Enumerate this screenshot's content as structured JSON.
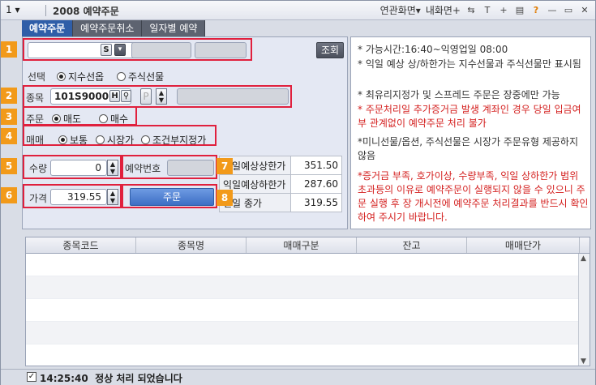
{
  "titlebar": {
    "screen_number": "1 ▾",
    "title": "2008 예약주문",
    "linked_screen": "연관화면▾",
    "my_screen": "내화면+",
    "help_icon_text": "?"
  },
  "tabs": [
    {
      "label": "예약주문"
    },
    {
      "label": "예약주문취소"
    },
    {
      "label": "일자별 예약"
    }
  ],
  "account": {
    "s_button": "S",
    "query_button": "조회"
  },
  "selection": {
    "label": "선택",
    "options": [
      "지수선옵",
      "주식선물"
    ]
  },
  "item": {
    "label": "종목",
    "code": "101S9000",
    "h_button": "H",
    "p_button": "P"
  },
  "order": {
    "label": "주문",
    "options": [
      "매도",
      "매수"
    ]
  },
  "trade": {
    "label": "매매",
    "options": [
      "보통",
      "시장가",
      "조건부지정가"
    ]
  },
  "quantity": {
    "label": "수량",
    "value": "0",
    "reservation_label": "예약번호"
  },
  "price": {
    "label": "가격",
    "value": "319.55",
    "order_button": "주문"
  },
  "price_table": [
    {
      "label": "익일예상상한가",
      "value": "351.50"
    },
    {
      "label": "익일예상하한가",
      "value": "287.60"
    },
    {
      "label": "전일 종가",
      "value": "319.55"
    }
  ],
  "badges": [
    "1",
    "2",
    "3",
    "4",
    "5",
    "6",
    "7",
    "8"
  ],
  "notices": [
    {
      "text": "* 가능시간:16:40~익영업일 08:00",
      "red": false
    },
    {
      "text": "* 익일 예상 상/하한가는 지수선물과 주식선물만 표시됨",
      "red": false
    },
    {
      "text": "* 최유리지정가 및 스프레드 주문은 장중에만 가능",
      "red": false
    },
    {
      "text": "* 주문처리일 추가증거금 발생 계좌인 경우 당일 입금여부 관계없이 예약주문 처리 불가",
      "red": true
    },
    {
      "text": "*미니선물/옵션, 주식선물은 시장가 주문유형 제공하지 않음",
      "red": false
    },
    {
      "text": "*증거금 부족, 호가이상, 수량부족, 익일 상하한가 범위 초과등의 이유로 예약주문이 실행되지 않을 수 있으니 주문 실행 후 장 개시전에 예약주문 처리결과를 반드시 확인하여 주시기 바랍니다.",
      "red": true
    }
  ],
  "grid": {
    "columns": [
      "종목코드",
      "종목명",
      "매매구분",
      "잔고",
      "매매단가"
    ]
  },
  "status": {
    "time": "14:25:40",
    "message": "정상 처리 되었습니다"
  },
  "colors": {
    "accent": "#2f5ea8",
    "highlight": "#e0203d",
    "badge": "#f29a1a"
  }
}
